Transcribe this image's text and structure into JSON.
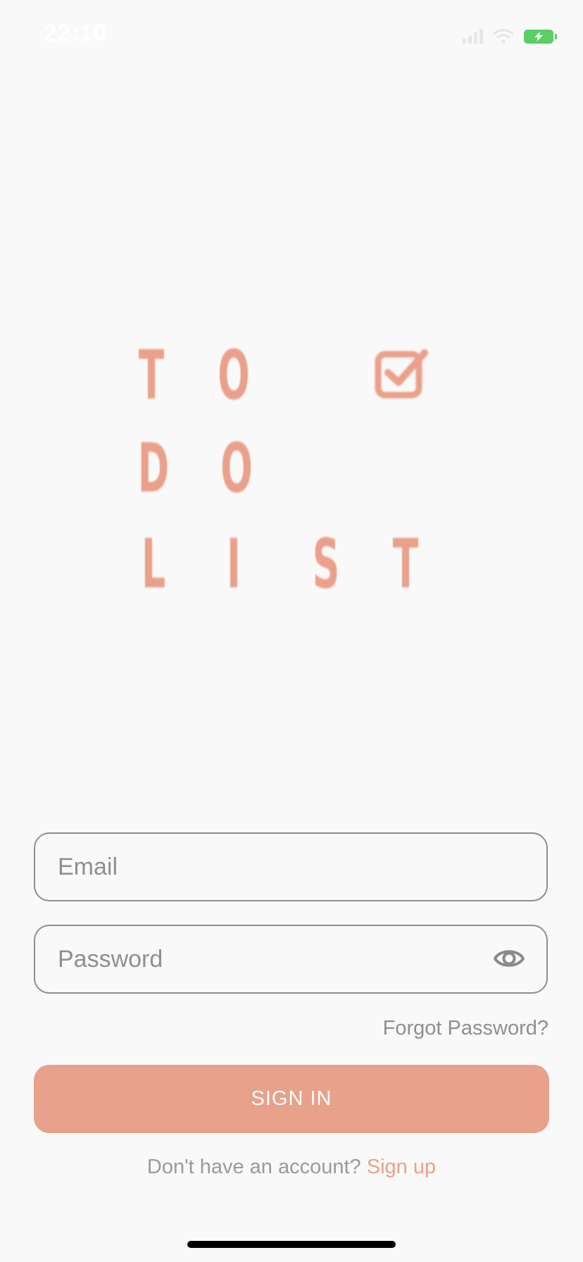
{
  "status_bar": {
    "time": "22:10",
    "battery_color": "#5ccf64"
  },
  "logo": {
    "letters": [
      "T",
      "O",
      "D",
      "O",
      "L",
      "I",
      "S",
      "T"
    ],
    "check_icon": "checkbox-checked-icon",
    "color": "#eaa08a"
  },
  "form": {
    "email_placeholder": "Email",
    "email_value": "",
    "password_placeholder": "Password",
    "password_value": "",
    "password_toggle_icon": "eye-icon",
    "forgot_password": "Forgot Password?",
    "sign_in": "SIGN IN",
    "no_account": "Don't have an account? ",
    "sign_up": "Sign up"
  },
  "colors": {
    "accent": "#e8a18b",
    "background": "#f9f9f9",
    "border": "#8e8e8e",
    "muted_text": "#8f8f8f"
  }
}
